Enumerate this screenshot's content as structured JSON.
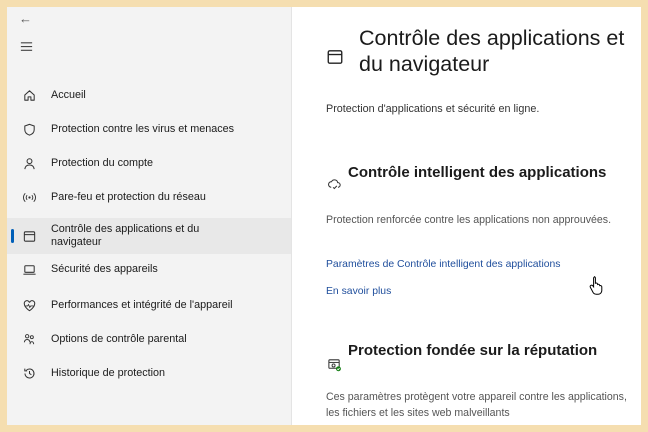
{
  "nav": {
    "back_icon": "arrow-left-icon",
    "menu_icon": "hamburger-icon",
    "items": [
      {
        "label": "Accueil",
        "icon": "home-icon"
      },
      {
        "label": "Protection contre les virus et menaces",
        "icon": "shield-icon"
      },
      {
        "label": "Protection du compte",
        "icon": "person-icon"
      },
      {
        "label": "Pare-feu et protection du réseau",
        "icon": "wifi-icon"
      },
      {
        "label": "Contrôle des applications et du navigateur",
        "icon": "app-window-icon",
        "active": true
      },
      {
        "label": "Sécurité des appareils",
        "icon": "laptop-icon"
      },
      {
        "label": "Performances et intégrité de l'appareil",
        "icon": "heart-icon"
      },
      {
        "label": "Options de contrôle parental",
        "icon": "family-icon"
      },
      {
        "label": "Historique de protection",
        "icon": "history-icon"
      }
    ]
  },
  "main": {
    "title": "Contrôle des applications et du navigateur",
    "subtitle": "Protection d'applications et sécurité en ligne.",
    "smart_control": {
      "title": "Contrôle intelligent des applications",
      "description": "Protection renforcée contre les applications non approuvées.",
      "settings_link": "Paramètres de Contrôle intelligent des applications",
      "learn_more_link": "En savoir plus"
    },
    "reputation": {
      "title": "Protection fondée sur la réputation",
      "description": "Ces paramètres protègent votre appareil contre les applications, les fichiers et les sites web malveillants"
    }
  },
  "colors": {
    "accent": "#005fb8",
    "link": "#1f4e9c",
    "frame": "#f5deb0"
  }
}
